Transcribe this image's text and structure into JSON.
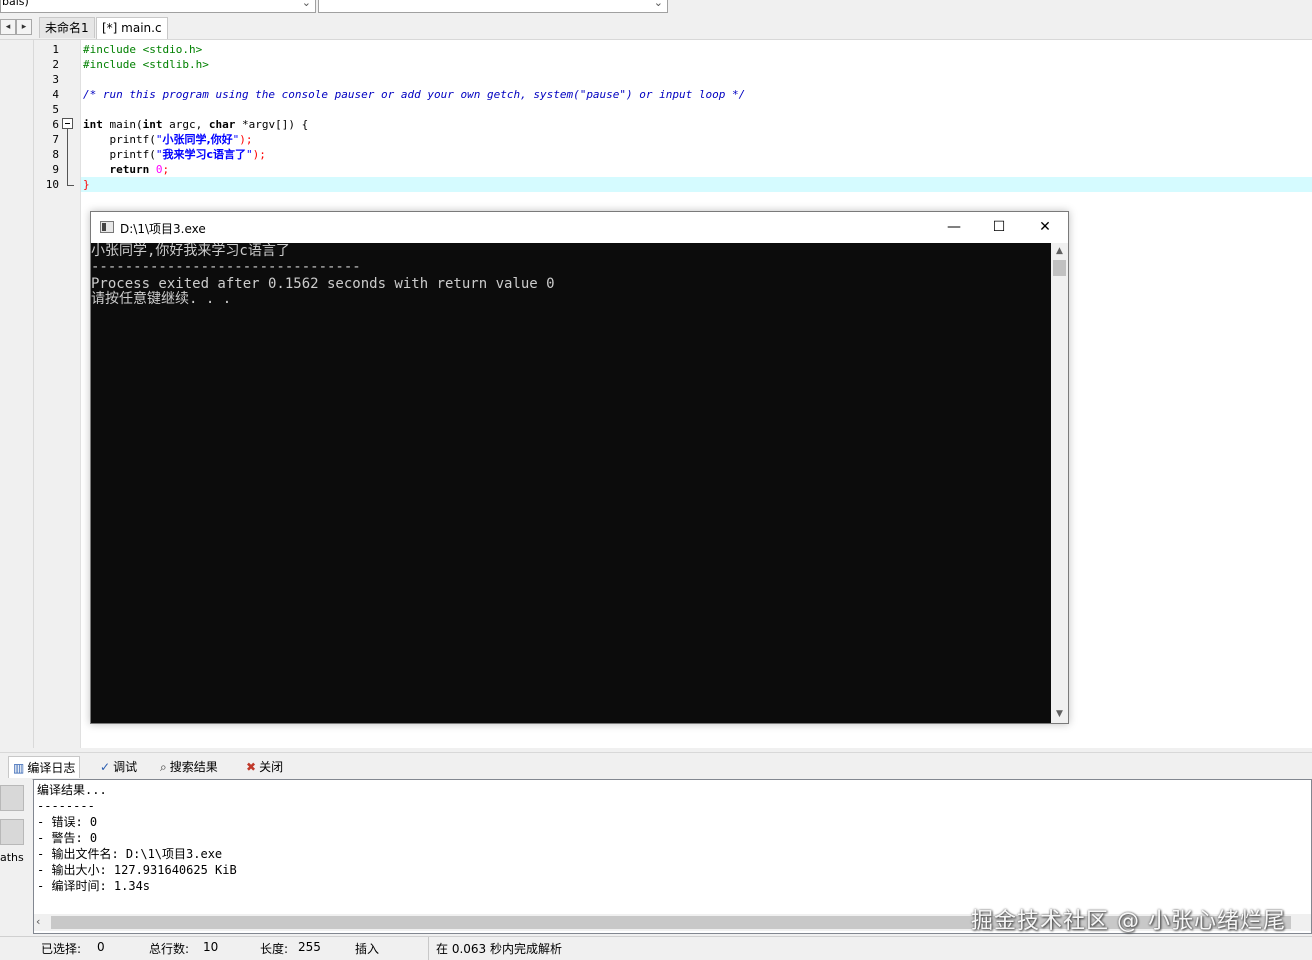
{
  "toolbar": {
    "combo1_text": "bals)"
  },
  "tabs": [
    {
      "label": "未命名1"
    },
    {
      "label": "[*] main.c"
    }
  ],
  "editor": {
    "line_numbers": [
      "1",
      "2",
      "3",
      "4",
      "5",
      "6",
      "7",
      "8",
      "9",
      "10"
    ],
    "code": {
      "l1": "#include <stdio.h>",
      "l2": "#include <stdlib.h>",
      "l4": "/* run this program using the console pauser or add your own getch, system(\"pause\") or input loop */",
      "l6_kw1": "int",
      "l6_a": " main(",
      "l6_kw2": "int",
      "l6_b": " argc, ",
      "l6_kw3": "char",
      "l6_c": " *argv[]) {",
      "l7_a": "    printf(",
      "l7_q1": "\"",
      "l7_cn": "小张同学,你好",
      "l7_q2": "\"",
      "l7_end": ");",
      "l8_a": "    printf(",
      "l8_q1": "\"",
      "l8_cn": "我来学习c语言了",
      "l8_q2": "\"",
      "l8_end": ");",
      "l9_kw": "    return",
      "l9_sp": " ",
      "l9_num": "0",
      "l9_end": ";",
      "l10": "}"
    }
  },
  "console": {
    "title": "D:\\1\\项目3.exe",
    "minimize": "—",
    "maximize": "☐",
    "close": "✕",
    "lines": [
      "小张同学,你好我来学习c语言了",
      "--------------------------------",
      "Process exited after 0.1562 seconds with return value 0",
      "请按任意键继续. . ."
    ]
  },
  "bottom_tabs": [
    {
      "label": "编译日志",
      "icon": "chart-icon"
    },
    {
      "label": "调试",
      "icon": "check-icon"
    },
    {
      "label": "搜索结果",
      "icon": "search-icon"
    },
    {
      "label": "关闭",
      "icon": "close-panel-icon"
    }
  ],
  "log": {
    "left_label": "aths",
    "lines": [
      "编译结果...",
      "--------",
      "- 错误: 0",
      "- 警告: 0",
      "- 输出文件名: D:\\1\\项目3.exe",
      "- 输出大小: 127.931640625 KiB",
      "- 编译时间: 1.34s"
    ]
  },
  "watermark": "掘金技术社区 @ 小张心绪烂尾",
  "status": {
    "selected_label": "已选择:",
    "selected_value": "0",
    "total_lines_label": "总行数:",
    "total_lines_value": "10",
    "length_label": "长度:",
    "length_value": "255",
    "mode": "插入",
    "parse_info": "在 0.063 秒内完成解析"
  }
}
